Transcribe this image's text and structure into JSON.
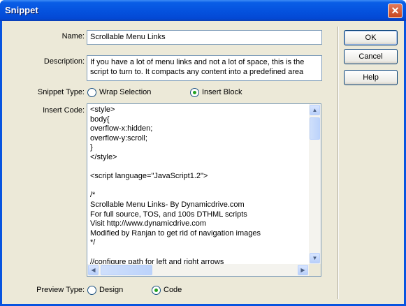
{
  "window": {
    "title": "Snippet",
    "close_glyph": "✕"
  },
  "name": {
    "label": "Name:",
    "value": "Scrollable Menu Links"
  },
  "description": {
    "label": "Description:",
    "value": "If you have a lot of menu links and not a lot of space, this is the script to turn to. It compacts any content into a predefined area"
  },
  "snippet_type": {
    "label": "Snippet Type:",
    "options": [
      "Wrap Selection",
      "Insert Block"
    ],
    "selected": "Insert Block"
  },
  "insert_code": {
    "label": "Insert Code:",
    "content": "<style>\nbody{\noverflow-x:hidden;\noverflow-y:scroll;\n}\n</style>\n\n<script language=\"JavaScript1.2\">\n\n/*\nScrollable Menu Links- By Dynamicdrive.com\nFor full source, TOS, and 100s DTHML scripts\nVisit http://www.dynamicdrive.com\nModified by Ranjan to get rid of navigation images\n*/\n\n//configure path for left and right arrows"
  },
  "preview_type": {
    "label": "Preview Type:",
    "options": [
      "Design",
      "Code"
    ],
    "selected": "Code"
  },
  "buttons": {
    "ok": "OK",
    "cancel": "Cancel",
    "help": "Help"
  },
  "icons": {
    "close": "close-icon",
    "up": "scroll-up-arrow-icon",
    "down": "scroll-down-arrow-icon",
    "left": "scroll-left-arrow-icon",
    "right": "scroll-right-arrow-icon"
  }
}
